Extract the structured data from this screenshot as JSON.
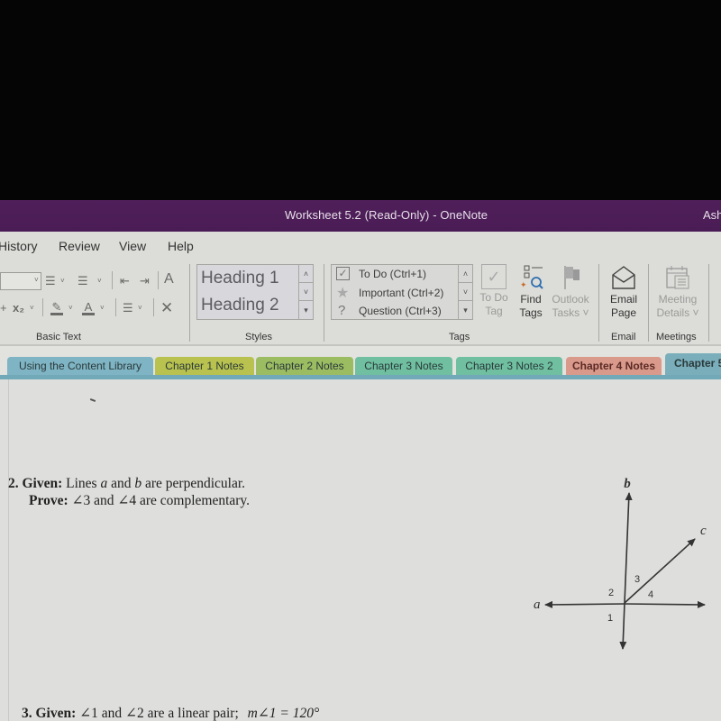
{
  "window": {
    "title": "Worksheet 5.2 (Read-Only)  -  OneNote",
    "user_partial": "Ash"
  },
  "menu": {
    "tabs": [
      "History",
      "Review",
      "View",
      "Help"
    ]
  },
  "ribbon": {
    "basic_text": {
      "label": "Basic Text",
      "icons": [
        "bullets-icon",
        "numbering-icon",
        "decrease-indent-icon",
        "increase-indent-icon",
        "clear-formatting-icon",
        "subscript-icon",
        "highlight-icon",
        "font-color-icon",
        "align-icon",
        "delete-icon"
      ]
    },
    "styles": {
      "label": "Styles",
      "items": [
        "Heading 1",
        "Heading 2"
      ]
    },
    "tags": {
      "label": "Tags",
      "items": [
        {
          "icon": "checkbox-icon",
          "label": "To Do (Ctrl+1)"
        },
        {
          "icon": "star-icon",
          "label": "Important (Ctrl+2)"
        },
        {
          "icon": "question-icon",
          "label": "Question (Ctrl+3)"
        }
      ],
      "todo_tag": [
        "To Do",
        "Tag"
      ],
      "find_tags": [
        "Find",
        "Tags"
      ],
      "outlook_tasks": [
        "Outlook",
        "Tasks ˅"
      ]
    },
    "email": {
      "label": "Email",
      "email_page": [
        "Email",
        "Page"
      ]
    },
    "meetings": {
      "label": "Meetings",
      "meeting_details": [
        "Meeting",
        "Details ˅"
      ]
    }
  },
  "sections": [
    {
      "label": "Using the Content Library",
      "color": "#7fb4c4"
    },
    {
      "label": "Chapter 1 Notes",
      "color": "#b9c24e"
    },
    {
      "label": "Chapter 2 Notes",
      "color": "#9cbc62"
    },
    {
      "label": "Chapter 3 Notes",
      "color": "#6fbfa0"
    },
    {
      "label": "Chapter 3 Notes 2",
      "color": "#6fbfa0"
    },
    {
      "label": "Chapter 4 Notes",
      "color": "#d99a8c",
      "active": true
    },
    {
      "label": "Chapter 5",
      "color": "#7aaebb"
    }
  ],
  "page": {
    "q2": {
      "number": "2.",
      "given_label": "Given:",
      "given_parts": [
        "Lines ",
        "a",
        " and ",
        "b",
        " are perpendicular."
      ],
      "prove_label": "Prove:",
      "prove_text": "∠3 and ∠4 are complementary."
    },
    "diagram": {
      "lines": [
        "a",
        "b",
        "c"
      ],
      "angles": [
        "1",
        "2",
        "3",
        "4"
      ]
    },
    "q3": {
      "number": "3.",
      "given_label": "Given:",
      "given_text": "∠1 and ∠2 are a linear pair;",
      "measure": "m∠1 = 120°"
    }
  }
}
